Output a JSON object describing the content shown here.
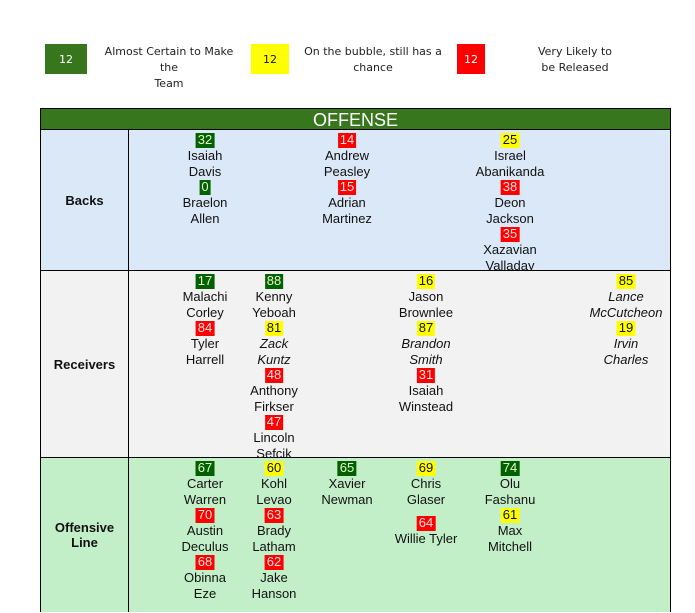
{
  "legend": [
    {
      "number": "12",
      "status": "green",
      "label_line1": "Almost Certain to Make the",
      "label_line2": "Team"
    },
    {
      "number": "12",
      "status": "yellow",
      "label_line1": "On the bubble, still has a",
      "label_line2": "chance"
    },
    {
      "number": "12",
      "status": "red",
      "label_line1": "Very Likely to",
      "label_line2": "be Released"
    }
  ],
  "colors": {
    "header_green": "#38761d",
    "status_green": "#006100",
    "status_yellow": "#ffff00",
    "status_red": "#ff0000",
    "backs_bg": "#dae8f7",
    "receivers_bg": "#f2f2f2",
    "oline_bg": "#c3efc8"
  },
  "section_title": "OFFENSE",
  "rows": [
    {
      "label_line1": "Backs",
      "label_line2": "",
      "columns": [
        [
          {
            "number": "32",
            "status": "green",
            "first": "Isaiah",
            "last": "Davis",
            "italic": false
          },
          {
            "number": "0",
            "status": "green",
            "first": "Braelon",
            "last": "Allen",
            "italic": false
          }
        ],
        [
          {
            "number": "14",
            "status": "red",
            "first": "Andrew",
            "last": "Peasley",
            "italic": false
          },
          {
            "number": "15",
            "status": "red",
            "first": "Adrian",
            "last": "Martinez",
            "italic": false
          }
        ],
        [
          {
            "number": "25",
            "status": "yellow",
            "first": "Israel",
            "last": "Abanikanda",
            "italic": false
          },
          {
            "number": "38",
            "status": "red",
            "first": "Deon",
            "last": "Jackson",
            "italic": false
          },
          {
            "number": "35",
            "status": "red",
            "first": "Xazavian",
            "last": "Valladay",
            "italic": false
          }
        ]
      ]
    },
    {
      "label_line1": "Receivers",
      "label_line2": "",
      "columns": [
        [
          {
            "number": "17",
            "status": "green",
            "first": "Malachi",
            "last": "Corley",
            "italic": false
          },
          {
            "number": "84",
            "status": "red",
            "first": "Tyler",
            "last": "Harrell",
            "italic": false
          }
        ],
        [
          {
            "number": "88",
            "status": "green",
            "first": "Kenny",
            "last": "Yeboah",
            "italic": false
          },
          {
            "number": "81",
            "status": "yellow",
            "first": "Zack",
            "last": "Kuntz",
            "italic": true
          },
          {
            "number": "48",
            "status": "red",
            "first": "Anthony",
            "last": "Firkser",
            "italic": false
          },
          {
            "number": "47",
            "status": "red",
            "first": "Lincoln",
            "last": "Sefcik",
            "italic": false
          }
        ],
        [
          {
            "number": "16",
            "status": "yellow",
            "first": "Jason",
            "last": "Brownlee",
            "italic": false
          },
          {
            "number": "87",
            "status": "yellow",
            "first": "Brandon",
            "last": "Smith",
            "italic": true
          },
          {
            "number": "31",
            "status": "red",
            "first": "Isaiah",
            "last": "Winstead",
            "italic": false
          }
        ],
        [
          {
            "number": "85",
            "status": "yellow",
            "first": "Lance",
            "last": "McCutcheon",
            "italic": true
          },
          {
            "number": "19",
            "status": "yellow",
            "first": "Irvin",
            "last": "Charles",
            "italic": true
          }
        ]
      ]
    },
    {
      "label_line1": "Offensive",
      "label_line2": "Line",
      "columns": [
        [
          {
            "number": "67",
            "status": "green",
            "first": "Carter",
            "last": "Warren",
            "italic": false
          },
          {
            "number": "70",
            "status": "red",
            "first": "Austin",
            "last": "Deculus",
            "italic": false
          },
          {
            "number": "68",
            "status": "red",
            "first": "Obinna",
            "last": "Eze",
            "italic": false
          }
        ],
        [
          {
            "number": "60",
            "status": "yellow",
            "first": "Kohl",
            "last": "Levao",
            "italic": false
          },
          {
            "number": "63",
            "status": "red",
            "first": "Brady",
            "last": "Latham",
            "italic": false
          },
          {
            "number": "62",
            "status": "red",
            "first": "Jake",
            "last": "Hanson",
            "italic": false
          }
        ],
        [
          {
            "number": "65",
            "status": "green",
            "first": "Xavier",
            "last": "Newman",
            "italic": false
          }
        ],
        [
          {
            "number": "69",
            "status": "yellow",
            "first": "Chris",
            "last": "Glaser",
            "italic": false
          },
          {
            "number": "64",
            "status": "red",
            "first": "Willie Tyler",
            "last": "",
            "italic": false
          }
        ],
        [
          {
            "number": "74",
            "status": "green",
            "first": "Olu",
            "last": "Fashanu",
            "italic": false
          },
          {
            "number": "61",
            "status": "yellow",
            "first": "Max",
            "last": "Mitchell",
            "italic": false
          }
        ]
      ]
    }
  ]
}
